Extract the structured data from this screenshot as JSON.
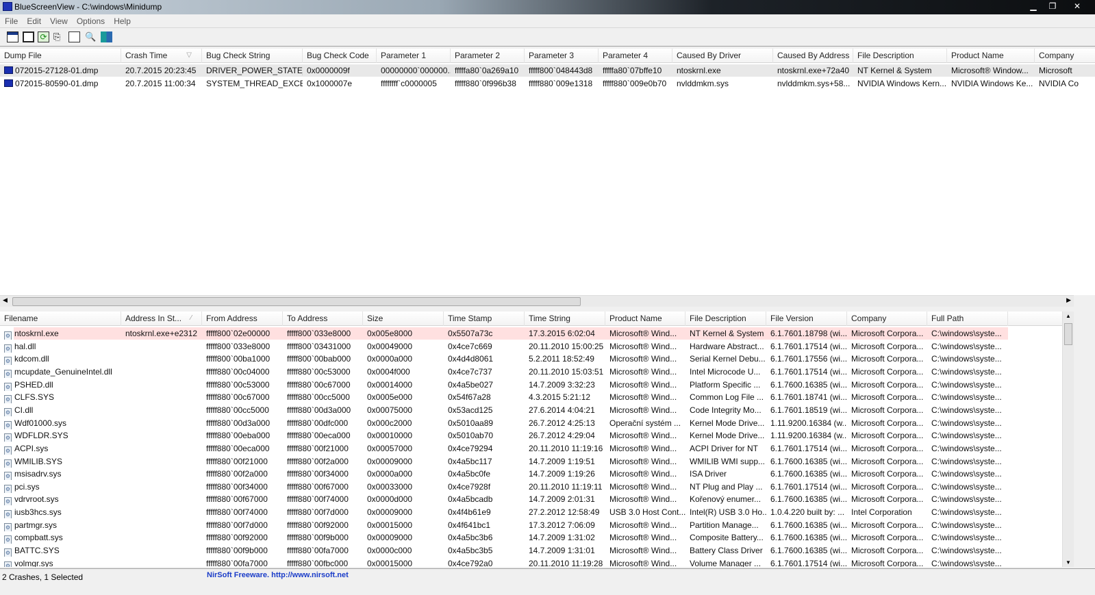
{
  "window": {
    "title": "BlueScreenView  -  C:\\windows\\Minidump",
    "minimize": "▁",
    "maximize": "❐",
    "close": "✕"
  },
  "menu": [
    "File",
    "Edit",
    "View",
    "Options",
    "Help"
  ],
  "toolbar": [
    "options-icon",
    "save-icon",
    "refresh-icon",
    "copy-icon",
    "properties-icon",
    "find-icon",
    "exit-icon"
  ],
  "crashes": {
    "columns": [
      "Dump File",
      "Crash Time",
      "Bug Check String",
      "Bug Check Code",
      "Parameter 1",
      "Parameter 2",
      "Parameter 3",
      "Parameter 4",
      "Caused By Driver",
      "Caused By Address",
      "File Description",
      "Product Name",
      "Company"
    ],
    "sort_indicator": "▽",
    "rows": [
      [
        "072015-27128-01.dmp",
        "20.7.2015 20:23:45",
        "DRIVER_POWER_STATE_...",
        "0x0000009f",
        "00000000`000000...",
        "fffffa80`0a269a10",
        "fffff800`048443d8",
        "fffffa80`07bffe10",
        "ntoskrnl.exe",
        "ntoskrnl.exe+72a40",
        "NT Kernel & System",
        "Microsoft® Window...",
        "Microsoft"
      ],
      [
        "072015-80590-01.dmp",
        "20.7.2015 11:00:34",
        "SYSTEM_THREAD_EXCE...",
        "0x1000007e",
        "ffffffff`c0000005",
        "fffff880`0f996b38",
        "fffff880`009e1318",
        "fffff880`009e0b70",
        "nvlddmkm.sys",
        "nvlddmkm.sys+58...",
        "NVIDIA Windows Kern...",
        "NVIDIA Windows Ke...",
        "NVIDIA Co"
      ]
    ]
  },
  "modules": {
    "columns": [
      "Filename",
      "Address In St...",
      "From Address",
      "To Address",
      "Size",
      "Time Stamp",
      "Time String",
      "Product Name",
      "File Description",
      "File Version",
      "Company",
      "Full Path"
    ],
    "sort_indicator": "⁄",
    "rows": [
      [
        "ntoskrnl.exe",
        "ntoskrnl.exe+e2312",
        "fffff800`02e00000",
        "fffff800`033e8000",
        "0x005e8000",
        "0x5507a73c",
        "17.3.2015 6:02:04",
        "Microsoft® Wind...",
        "NT Kernel & System",
        "6.1.7601.18798 (wi...",
        "Microsoft Corpora...",
        "C:\\windows\\syste..."
      ],
      [
        "hal.dll",
        "",
        "fffff800`033e8000",
        "fffff800`03431000",
        "0x00049000",
        "0x4ce7c669",
        "20.11.2010 15:00:25",
        "Microsoft® Wind...",
        "Hardware Abstract...",
        "6.1.7601.17514 (wi...",
        "Microsoft Corpora...",
        "C:\\windows\\syste..."
      ],
      [
        "kdcom.dll",
        "",
        "fffff800`00ba1000",
        "fffff800`00bab000",
        "0x0000a000",
        "0x4d4d8061",
        "5.2.2011 18:52:49",
        "Microsoft® Wind...",
        "Serial Kernel Debu...",
        "6.1.7601.17556 (wi...",
        "Microsoft Corpora...",
        "C:\\windows\\syste..."
      ],
      [
        "mcupdate_GenuineIntel.dll",
        "",
        "fffff880`00c04000",
        "fffff880`00c53000",
        "0x0004f000",
        "0x4ce7c737",
        "20.11.2010 15:03:51",
        "Microsoft® Wind...",
        "Intel Microcode U...",
        "6.1.7601.17514 (wi...",
        "Microsoft Corpora...",
        "C:\\windows\\syste..."
      ],
      [
        "PSHED.dll",
        "",
        "fffff880`00c53000",
        "fffff880`00c67000",
        "0x00014000",
        "0x4a5be027",
        "14.7.2009 3:32:23",
        "Microsoft® Wind...",
        "Platform Specific ...",
        "6.1.7600.16385 (wi...",
        "Microsoft Corpora...",
        "C:\\windows\\syste..."
      ],
      [
        "CLFS.SYS",
        "",
        "fffff880`00c67000",
        "fffff880`00cc5000",
        "0x0005e000",
        "0x54f67a28",
        "4.3.2015 5:21:12",
        "Microsoft® Wind...",
        "Common Log File ...",
        "6.1.7601.18741 (wi...",
        "Microsoft Corpora...",
        "C:\\windows\\syste..."
      ],
      [
        "CI.dll",
        "",
        "fffff880`00cc5000",
        "fffff880`00d3a000",
        "0x00075000",
        "0x53acd125",
        "27.6.2014 4:04:21",
        "Microsoft® Wind...",
        "Code Integrity Mo...",
        "6.1.7601.18519 (wi...",
        "Microsoft Corpora...",
        "C:\\windows\\syste..."
      ],
      [
        "Wdf01000.sys",
        "",
        "fffff880`00d3a000",
        "fffff880`00dfc000",
        "0x000c2000",
        "0x5010aa89",
        "26.7.2012 4:25:13",
        "Operační systém ...",
        "Kernel Mode Drive...",
        "1.11.9200.16384 (w...",
        "Microsoft Corpora...",
        "C:\\windows\\syste..."
      ],
      [
        "WDFLDR.SYS",
        "",
        "fffff880`00eba000",
        "fffff880`00eca000",
        "0x00010000",
        "0x5010ab70",
        "26.7.2012 4:29:04",
        "Microsoft® Wind...",
        "Kernel Mode Drive...",
        "1.11.9200.16384 (w...",
        "Microsoft Corpora...",
        "C:\\windows\\syste..."
      ],
      [
        "ACPI.sys",
        "",
        "fffff880`00eca000",
        "fffff880`00f21000",
        "0x00057000",
        "0x4ce79294",
        "20.11.2010 11:19:16",
        "Microsoft® Wind...",
        "ACPI Driver for NT",
        "6.1.7601.17514 (wi...",
        "Microsoft Corpora...",
        "C:\\windows\\syste..."
      ],
      [
        "WMILIB.SYS",
        "",
        "fffff880`00f21000",
        "fffff880`00f2a000",
        "0x00009000",
        "0x4a5bc117",
        "14.7.2009 1:19:51",
        "Microsoft® Wind...",
        "WMILIB WMI supp...",
        "6.1.7600.16385 (wi...",
        "Microsoft Corpora...",
        "C:\\windows\\syste..."
      ],
      [
        "msisadrv.sys",
        "",
        "fffff880`00f2a000",
        "fffff880`00f34000",
        "0x0000a000",
        "0x4a5bc0fe",
        "14.7.2009 1:19:26",
        "Microsoft® Wind...",
        "ISA Driver",
        "6.1.7600.16385 (wi...",
        "Microsoft Corpora...",
        "C:\\windows\\syste..."
      ],
      [
        "pci.sys",
        "",
        "fffff880`00f34000",
        "fffff880`00f67000",
        "0x00033000",
        "0x4ce7928f",
        "20.11.2010 11:19:11",
        "Microsoft® Wind...",
        "NT Plug and Play ...",
        "6.1.7601.17514 (wi...",
        "Microsoft Corpora...",
        "C:\\windows\\syste..."
      ],
      [
        "vdrvroot.sys",
        "",
        "fffff880`00f67000",
        "fffff880`00f74000",
        "0x0000d000",
        "0x4a5bcadb",
        "14.7.2009 2:01:31",
        "Microsoft® Wind...",
        "Kořenový enumer...",
        "6.1.7600.16385 (wi...",
        "Microsoft Corpora...",
        "C:\\windows\\syste..."
      ],
      [
        "iusb3hcs.sys",
        "",
        "fffff880`00f74000",
        "fffff880`00f7d000",
        "0x00009000",
        "0x4f4b61e9",
        "27.2.2012 12:58:49",
        "USB 3.0 Host Cont...",
        "Intel(R) USB 3.0 Ho...",
        "1.0.4.220 built by: ...",
        "Intel Corporation",
        "C:\\windows\\syste..."
      ],
      [
        "partmgr.sys",
        "",
        "fffff880`00f7d000",
        "fffff880`00f92000",
        "0x00015000",
        "0x4f641bc1",
        "17.3.2012 7:06:09",
        "Microsoft® Wind...",
        "Partition Manage...",
        "6.1.7600.16385 (wi...",
        "Microsoft Corpora...",
        "C:\\windows\\syste..."
      ],
      [
        "compbatt.sys",
        "",
        "fffff880`00f92000",
        "fffff880`00f9b000",
        "0x00009000",
        "0x4a5bc3b6",
        "14.7.2009 1:31:02",
        "Microsoft® Wind...",
        "Composite Battery...",
        "6.1.7600.16385 (wi...",
        "Microsoft Corpora...",
        "C:\\windows\\syste..."
      ],
      [
        "BATTC.SYS",
        "",
        "fffff880`00f9b000",
        "fffff880`00fa7000",
        "0x0000c000",
        "0x4a5bc3b5",
        "14.7.2009 1:31:01",
        "Microsoft® Wind...",
        "Battery Class Driver",
        "6.1.7600.16385 (wi...",
        "Microsoft Corpora...",
        "C:\\windows\\syste..."
      ],
      [
        "volmgr.sys",
        "",
        "fffff880`00fa7000",
        "fffff880`00fbc000",
        "0x00015000",
        "0x4ce792a0",
        "20.11.2010 11:19:28",
        "Microsoft® Wind...",
        "Volume Manager ...",
        "6.1.7601.17514 (wi...",
        "Microsoft Corpora...",
        "C:\\windows\\syste..."
      ]
    ]
  },
  "status": {
    "count": "2 Crashes, 1 Selected",
    "credit": "NirSoft Freeware.  http://www.nirsoft.net"
  },
  "colors": {
    "highlight_row": "#ffe0e0",
    "selected_row": "#e8e8e8",
    "link": "#1a3cc8"
  }
}
